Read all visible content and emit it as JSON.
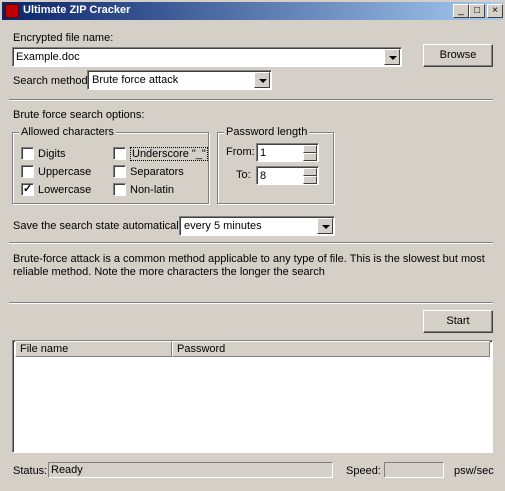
{
  "window": {
    "title": "Ultimate ZIP Cracker",
    "minimize": "_",
    "maximize": "□",
    "close": "×"
  },
  "file": {
    "label": "Encrypted file name:",
    "value": "Example.doc",
    "browse_label": "Browse"
  },
  "search": {
    "label": "Search method:",
    "value": "Brute force attack"
  },
  "brute": {
    "heading": "Brute force search options:",
    "allowed_title": "Allowed characters",
    "checkboxes": [
      {
        "label": "Digits",
        "checked": false
      },
      {
        "label": "Uppercase",
        "checked": false
      },
      {
        "label": "Lowercase",
        "checked": true
      },
      {
        "label": "Underscore \"_\"",
        "checked": false
      },
      {
        "label": "Separators",
        "checked": false
      },
      {
        "label": "Non-latin",
        "checked": false
      }
    ],
    "length_title": "Password length",
    "from_label": "From:",
    "from_value": "1",
    "to_label": "To:",
    "to_value": "8"
  },
  "save": {
    "label": "Save the search state automatically:",
    "value": "every 5 minutes"
  },
  "description": "Brute-force attack is a common method applicable to any type of file. This is the slowest but most reliable method. Note the more characters the longer the search",
  "start_label": "Start",
  "results": {
    "columns": [
      "File name",
      "Password"
    ]
  },
  "status": {
    "status_label": "Status:",
    "status_value": "Ready",
    "speed_label": "Speed:",
    "speed_value": "",
    "speed_unit": "psw/sec"
  }
}
